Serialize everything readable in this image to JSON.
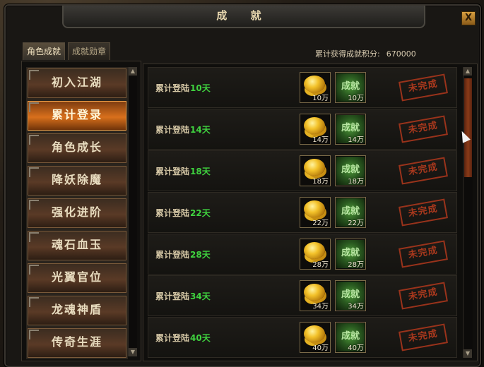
{
  "window": {
    "title": "成 就",
    "close_label": "X"
  },
  "tabs": [
    {
      "label": "角色成就",
      "active": true
    },
    {
      "label": "成就勋章",
      "active": false
    }
  ],
  "score": {
    "label": "累计获得成就积分:",
    "value": "670000"
  },
  "categories": [
    {
      "label": "初入江湖",
      "selected": false
    },
    {
      "label": "累计登录",
      "selected": true
    },
    {
      "label": "角色成长",
      "selected": false
    },
    {
      "label": "降妖除魔",
      "selected": false
    },
    {
      "label": "强化进阶",
      "selected": false
    },
    {
      "label": "魂石血玉",
      "selected": false
    },
    {
      "label": "光翼官位",
      "selected": false
    },
    {
      "label": "龙魂神盾",
      "selected": false
    },
    {
      "label": "传奇生涯",
      "selected": false
    }
  ],
  "achievements": [
    {
      "prefix": "累计登陆",
      "days": "10天",
      "coin_amount": "10万",
      "ach_amount": "10万",
      "status": "未完成"
    },
    {
      "prefix": "累计登陆",
      "days": "14天",
      "coin_amount": "14万",
      "ach_amount": "14万",
      "status": "未完成"
    },
    {
      "prefix": "累计登陆",
      "days": "18天",
      "coin_amount": "18万",
      "ach_amount": "18万",
      "status": "未完成"
    },
    {
      "prefix": "累计登陆",
      "days": "22天",
      "coin_amount": "22万",
      "ach_amount": "22万",
      "status": "未完成"
    },
    {
      "prefix": "累计登陆",
      "days": "28天",
      "coin_amount": "28万",
      "ach_amount": "28万",
      "status": "未完成"
    },
    {
      "prefix": "累计登陆",
      "days": "34天",
      "coin_amount": "34万",
      "ach_amount": "34万",
      "status": "未完成"
    },
    {
      "prefix": "累计登陆",
      "days": "40天",
      "coin_amount": "40万",
      "ach_amount": "40万",
      "status": "未完成"
    }
  ],
  "ach_icon_text": "成就",
  "icons": {
    "coin": "gold-coins-icon",
    "achievement": "achievement-icon",
    "scroll_up": "arrow-up-icon",
    "scroll_down": "arrow-down-icon"
  },
  "colors": {
    "accent": "#d8701c",
    "days_green": "#3fd23f",
    "stamp_red": "#b83c1e"
  }
}
